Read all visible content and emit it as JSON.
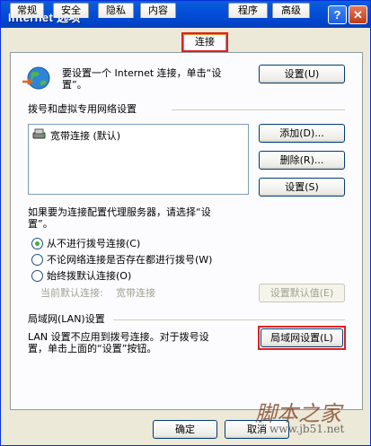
{
  "window": {
    "title": "Internet 选项",
    "help_label": "?",
    "close_label": "✕"
  },
  "tabs": [
    {
      "label": "常规"
    },
    {
      "label": "安全"
    },
    {
      "label": "隐私"
    },
    {
      "label": "内容"
    },
    {
      "label": "连接",
      "active": true
    },
    {
      "label": "程序"
    },
    {
      "label": "高级"
    }
  ],
  "setup": {
    "text": "要设置一个 Internet 连接，单击“设置”。",
    "line1": "要设置一个 Internet 连接，单击“设",
    "line2": "置”。",
    "button": "设置(U)"
  },
  "dialup": {
    "heading": "拨号和虚拟专用网络设置",
    "items": [
      {
        "label": "宽带连接 (默认)"
      }
    ],
    "add_button": "添加(D)...",
    "remove_button": "删除(R)...",
    "settings_button": "设置(S)",
    "proxy_note_line1": "如果要为连接配置代理服务器，请选择“设",
    "proxy_note_line2": "置”。",
    "options": [
      {
        "label": "从不进行拨号连接(C)",
        "selected": true
      },
      {
        "label": "不论网络连接是否存在都进行拨号(W)",
        "selected": false
      },
      {
        "label": "始终拨默认连接(O)",
        "selected": false
      }
    ],
    "current_default_label": "当前默认连接:",
    "current_default_value": "宽带连接",
    "set_default_button": "设置默认值(E)"
  },
  "lan": {
    "heading": "局域网(LAN)设置",
    "note_line1": "LAN 设置不应用到拨号连接。对于拨号设",
    "note_line2": "置，单击上面的“设置”按钮。",
    "button": "局域网设置(L)"
  },
  "footer": {
    "ok_button": "确定",
    "cancel_button": "取消"
  },
  "watermark": {
    "line1": "脚本之家",
    "line2": "www.jb51.net"
  },
  "colors": {
    "titlebar": "#0350d8",
    "highlight": "#e02020",
    "dialog_bg": "#ece9d8"
  }
}
